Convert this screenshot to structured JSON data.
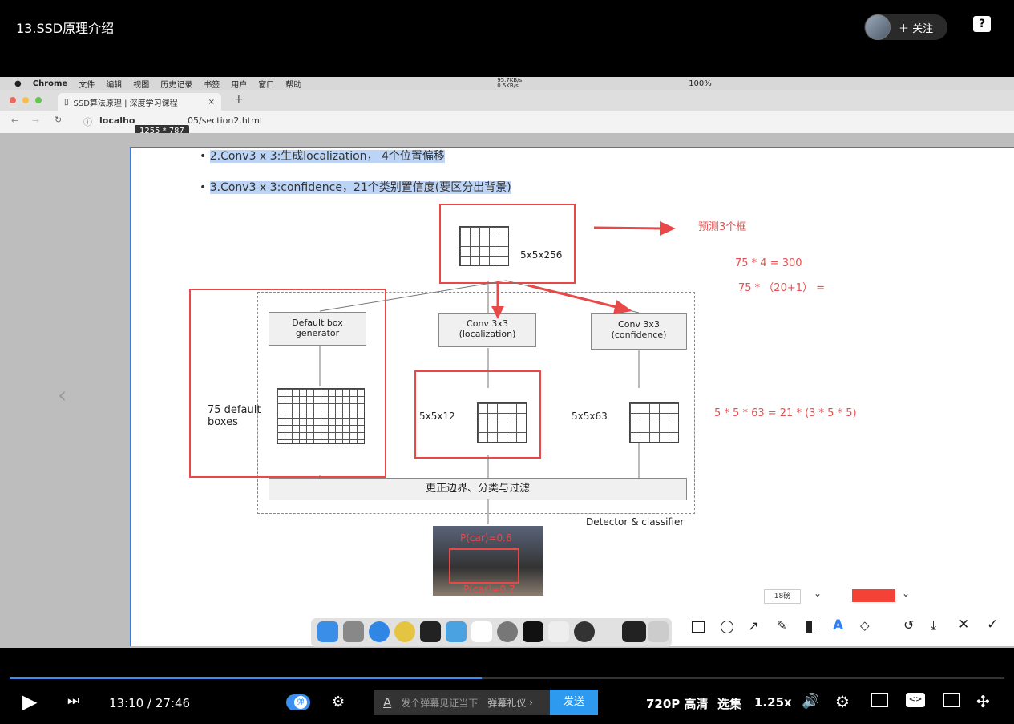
{
  "header": {
    "title": "13.SSD原理介绍",
    "follow_label": "关注",
    "help_icon": "question-icon"
  },
  "mac_menubar": {
    "app": "Chrome",
    "items": [
      "文件",
      "编辑",
      "视图",
      "历史记录",
      "书签",
      "用户",
      "窗口",
      "帮助"
    ],
    "net_up": "95.7KB/s",
    "net_down": "0.5KB/s",
    "battery": "100%"
  },
  "browser": {
    "tab_title": "SSD算法原理 | 深度学习课程",
    "url_left": "localho",
    "url_right": "05/section2.html",
    "size_tip": "1255 * 787"
  },
  "slide": {
    "bullet1": "2.Conv3 x 3:生成localization， 4个位置偏移",
    "bullet2": "3.Conv3 x 3:confidence，21个类别置信度(要区分出背景)",
    "top_feature": "5x5x256",
    "default_box": "Default box generator",
    "conv_loc": "Conv 3x3 (localization)",
    "conv_conf": "Conv 3x3 (confidence)",
    "default_boxes_label": "75 default boxes",
    "loc_feature": "5x5x12",
    "conf_feature": "5x5x63",
    "bottom_bar": "更正边界、分类与过滤",
    "detector_label": "Detector & classifier",
    "car_label1": "P(car)=0.6",
    "car_label2": "P(car)=0.7",
    "note_predict": "预测3个框",
    "note_calc1": "75 * 4 = 300",
    "note_calc2": "75 * （20+1） =",
    "note_calc3": "5 * 5 * 63 = 21 * (3 * 5 * 5)"
  },
  "annotation_tool": {
    "font_size": "18磅",
    "color": "#f44336"
  },
  "player": {
    "current_time": "13:10",
    "separator": "/",
    "total_time": "27:46",
    "danmaku_toggle_label": "弹",
    "danmaku_placeholder": "发个弹幕见证当下",
    "danmaku_etiquette": "弹幕礼仪",
    "send_label": "发送",
    "quality": "720P 高清",
    "episodes": "选集",
    "speed": "1.25x",
    "progress_fraction": 0.475
  }
}
